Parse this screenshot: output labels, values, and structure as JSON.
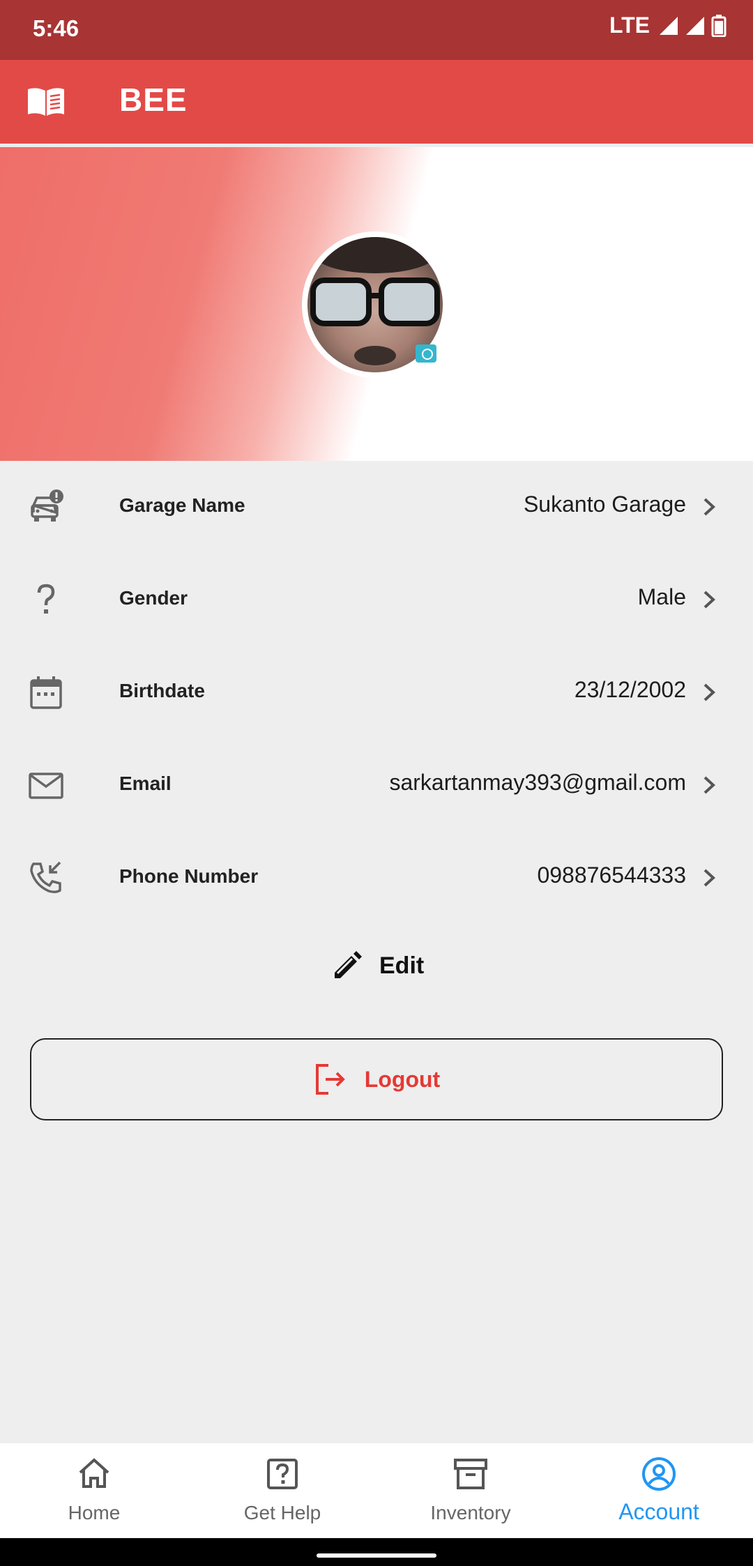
{
  "status_bar": {
    "time": "5:46",
    "network": "LTE"
  },
  "app_bar": {
    "title": "BEE"
  },
  "profile": {
    "camera_icon": "camera-icon"
  },
  "info_rows": [
    {
      "icon": "car-alert-icon",
      "label": "Garage Name",
      "value": "Sukanto Garage"
    },
    {
      "icon": "question-icon",
      "label": "Gender",
      "value": "Male"
    },
    {
      "icon": "calendar-icon",
      "label": "Birthdate",
      "value": "23/12/2002"
    },
    {
      "icon": "mail-icon",
      "label": "Email",
      "value": "sarkartanmay393@gmail.com"
    },
    {
      "icon": "phone-callback-icon",
      "label": "Phone Number",
      "value": "098876544333"
    }
  ],
  "actions": {
    "edit_label": "Edit",
    "logout_label": "Logout"
  },
  "bottom_nav": {
    "items": [
      {
        "label": "Home",
        "icon": "home-icon",
        "active": false
      },
      {
        "label": "Get Help",
        "icon": "help-icon",
        "active": false
      },
      {
        "label": "Inventory",
        "icon": "archive-icon",
        "active": false
      },
      {
        "label": "Account",
        "icon": "account-circle-icon",
        "active": true
      }
    ]
  },
  "colors": {
    "status_bar": "#a83434",
    "app_bar": "#e24a47",
    "accent": "#2196f3",
    "logout": "#e53935",
    "background": "#eeeeee"
  }
}
